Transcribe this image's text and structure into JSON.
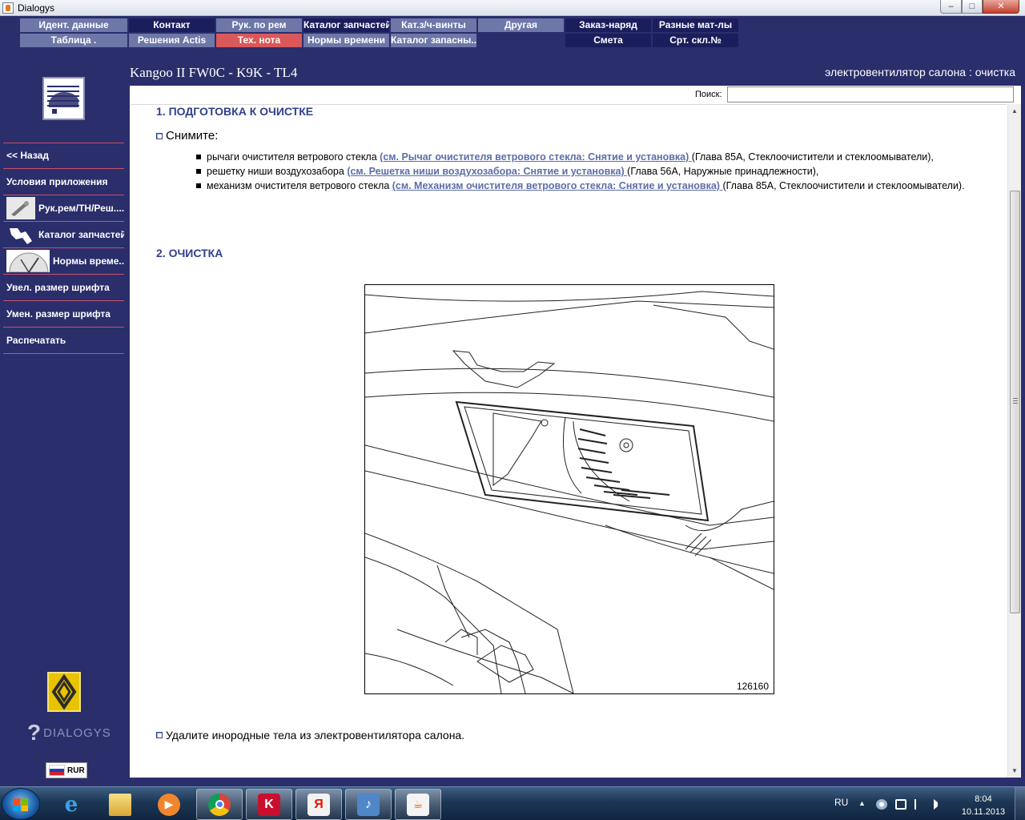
{
  "window": {
    "title": "Dialogys",
    "min": "–",
    "max": "□",
    "close": "✕"
  },
  "menu": {
    "row1": [
      "Идент. данные",
      "Контакт",
      "Рук. по рем",
      "Каталог запчастей",
      "Кат.з/ч-винты",
      "Другая",
      "Заказ-наряд",
      "Разные мат-лы"
    ],
    "row2": [
      "Таблица .",
      "Решения Actis",
      "Тех. нота",
      "Нормы времени",
      "Каталог запасны...",
      "",
      "Смета",
      "Срт. скл.№"
    ],
    "active": "Тех. нота"
  },
  "header": {
    "vehicle": "Kangoo II FW0C - K9K - TL4",
    "page_title": "электровентилятор салона : очистка"
  },
  "sidebar": {
    "items": [
      {
        "label": "<< Назад",
        "icon": ""
      },
      {
        "label": "Условия приложения",
        "icon": ""
      },
      {
        "label": "Рук.рем/ТН/Реш....",
        "icon": "wrench-icon"
      },
      {
        "label": "Каталог запчастей",
        "icon": "parts-icon"
      },
      {
        "label": "Нормы време...",
        "icon": "clock-icon"
      },
      {
        "label": "Увел. размер шрифта",
        "icon": ""
      },
      {
        "label": "Умен. размер шрифта",
        "icon": ""
      },
      {
        "label": "Распечатать",
        "icon": ""
      }
    ],
    "brand": "DIALOGYS",
    "currency": "RUR"
  },
  "search": {
    "label": "Поиск:",
    "value": ""
  },
  "doc": {
    "section1": "1. ПОДГОТОВКА К ОЧИСТКЕ",
    "remove_lead": "Снимите:",
    "steps": [
      {
        "pre": "рычаги очистителя ветрового стекла ",
        "link": "(см. Рычаг очистителя ветрового стекла: Снятие и установка) ",
        "post": "(Глава 85A, Стеклоочистители и стеклоомыватели),"
      },
      {
        "pre": "решетку ниши воздухозабора ",
        "link": "(см. Решетка ниши воздухозабора: Снятие и установка) ",
        "post": "(Глава 56A, Наружные принадлежности),"
      },
      {
        "pre": "механизм очистителя ветрового стекла ",
        "link": "(см. Механизм очистителя ветрового стекла: Снятие и установка) ",
        "post": "(Глава 85A, Стеклоочистители и стеклоомыватели)."
      }
    ],
    "section2": "2. ОЧИСТКА",
    "figure_number": "126160",
    "final_step": "Удалите инородные тела из электровентилятора салона."
  },
  "taskbar": {
    "apps": [
      "ie-icon",
      "explorer-icon",
      "media-player-icon",
      "chrome-icon",
      "kaspersky-icon",
      "yandex-icon",
      "sound-icon",
      "java-icon"
    ],
    "lang": "RU",
    "time": "8:04",
    "date": "10.11.2013"
  }
}
